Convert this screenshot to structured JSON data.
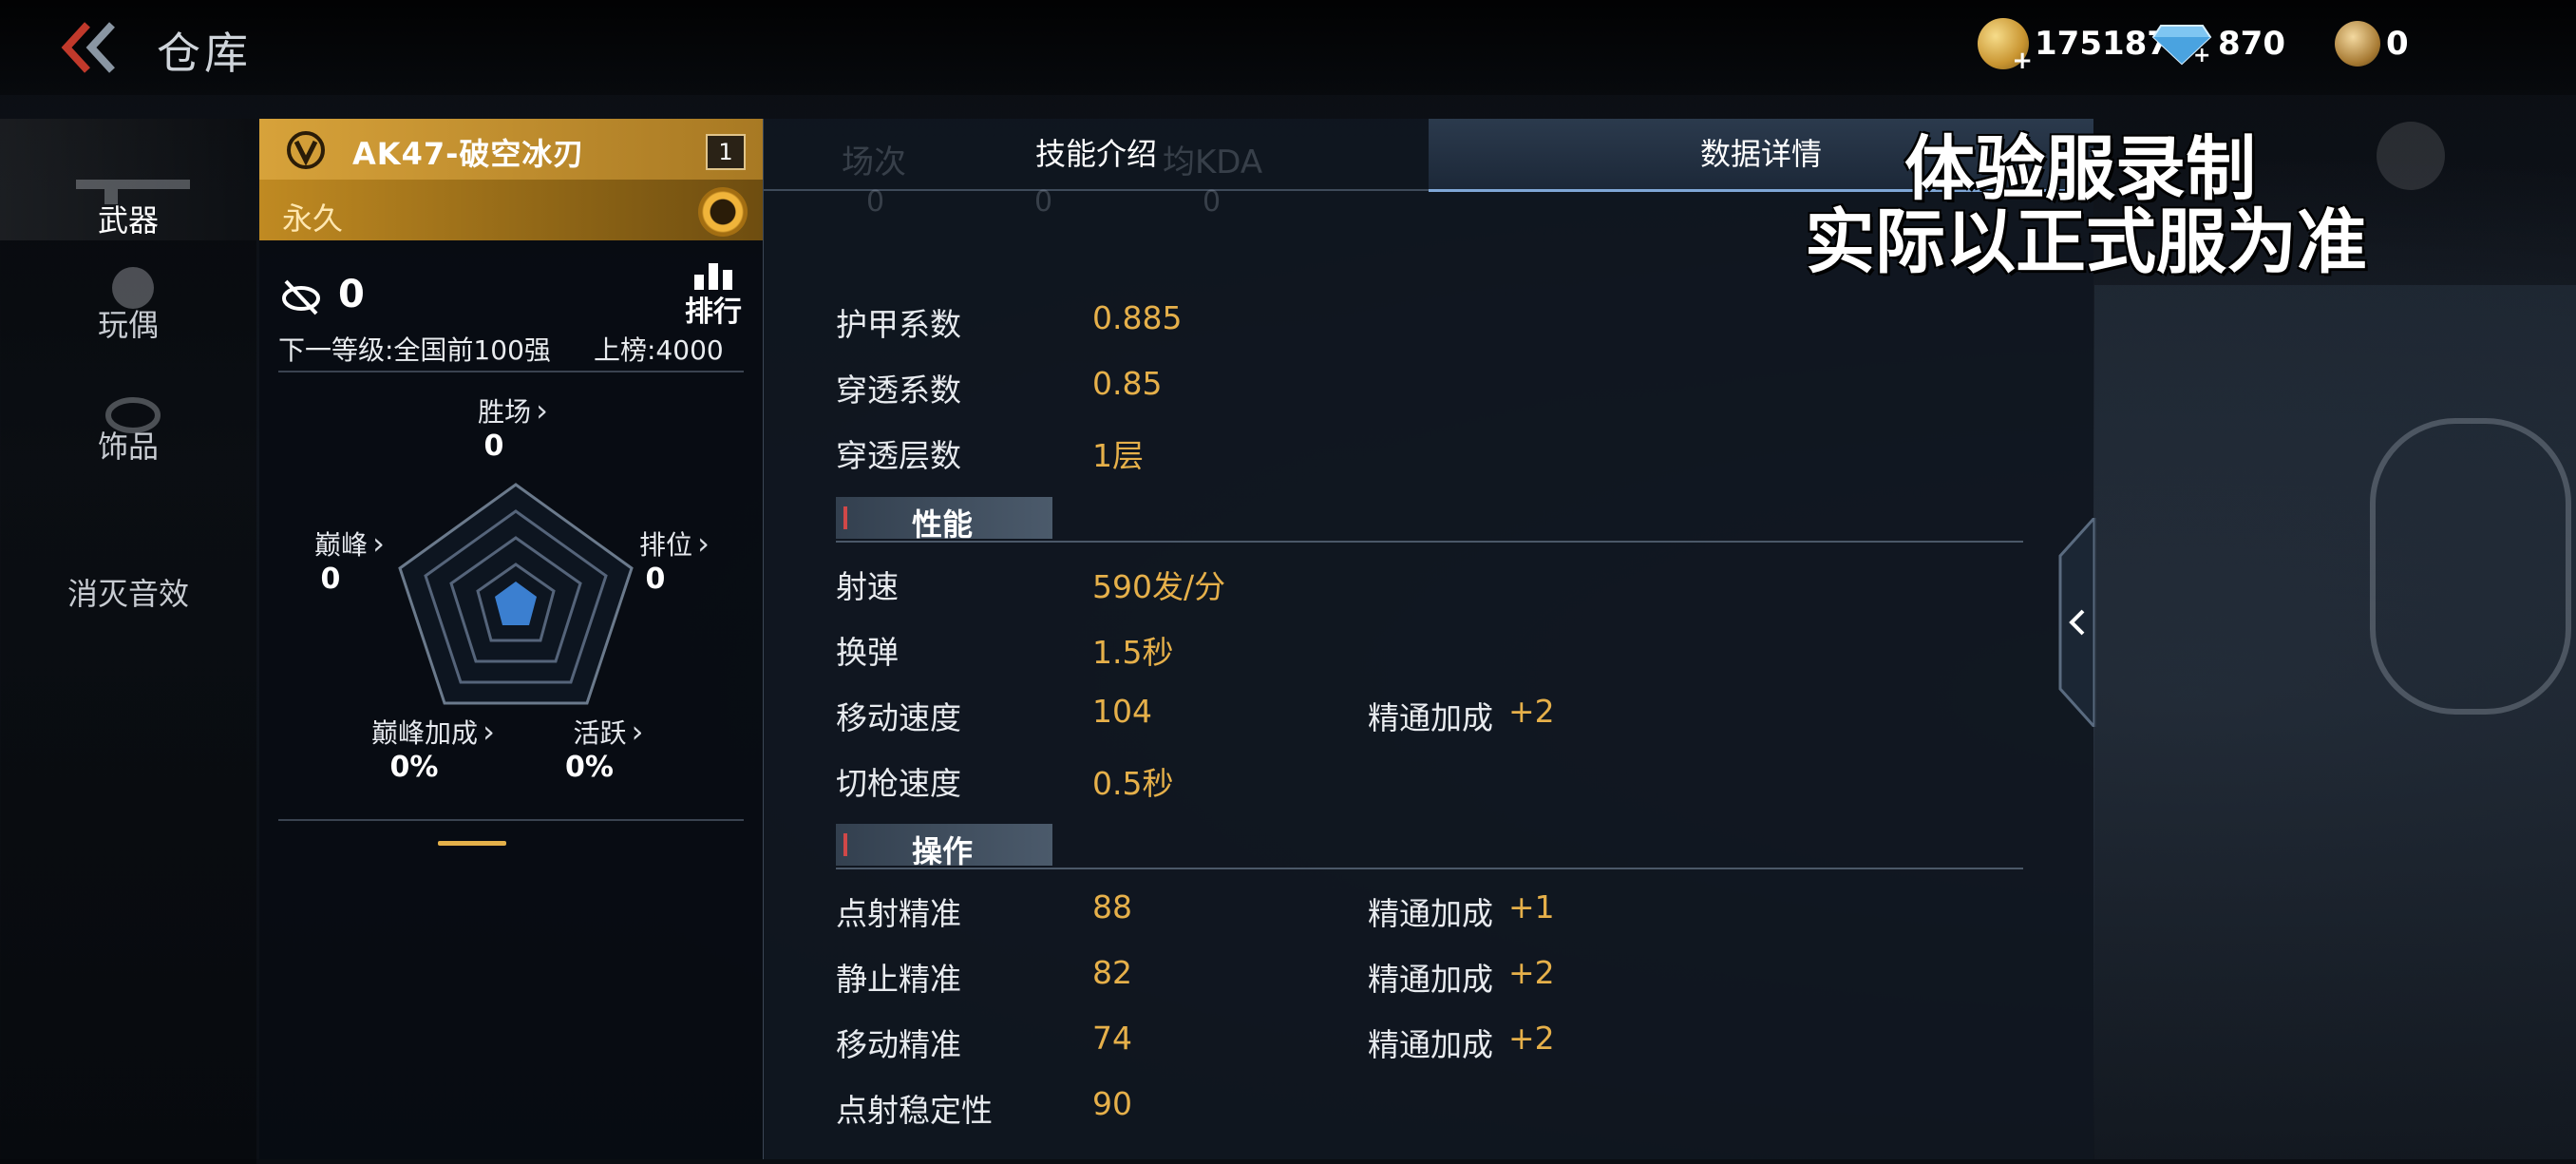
{
  "header": {
    "title": "仓库",
    "currencies": {
      "gold": "175187",
      "diamond": "870",
      "medal": "0"
    }
  },
  "sidebar": {
    "items": [
      {
        "label": "武器"
      },
      {
        "label": "玩偶"
      },
      {
        "label": "饰品"
      },
      {
        "label": "消灭音效"
      }
    ]
  },
  "card": {
    "weapon_name": "AK47-破空冰刃",
    "level": "1",
    "duration": "永久",
    "rank_count": "0",
    "rank_label": "排行",
    "next_level": "下一等级:全国前100强",
    "board_score": "上榜:4000",
    "stats": {
      "wins": {
        "label": "胜场",
        "value": "0"
      },
      "peak": {
        "label": "巅峰",
        "value": "0"
      },
      "ranked": {
        "label": "排位",
        "value": "0"
      },
      "peak_bonus": {
        "label": "巅峰加成",
        "value": "0%"
      },
      "active": {
        "label": "活跃",
        "value": "0%"
      }
    }
  },
  "panel": {
    "tabs": [
      {
        "label": "技能介绍"
      },
      {
        "label": "数据详情"
      }
    ],
    "ghost": {
      "matches": "场次",
      "kda": "均KDA",
      "zero": "0"
    },
    "rows_top": [
      {
        "key": "护甲系数",
        "value": "0.885"
      },
      {
        "key": "穿透系数",
        "value": "0.85"
      },
      {
        "key": "穿透层数",
        "value": "1层"
      }
    ],
    "section_performance": "性能",
    "rows_perf": [
      {
        "key": "射速",
        "value": "590发/分"
      },
      {
        "key": "换弹",
        "value": "1.5秒"
      },
      {
        "key": "移动速度",
        "value": "104",
        "bonus_label": "精通加成",
        "bonus": "+2"
      },
      {
        "key": "切枪速度",
        "value": "0.5秒"
      }
    ],
    "section_operation": "操作",
    "rows_op": [
      {
        "key": "点射精准",
        "value": "88",
        "bonus_label": "精通加成",
        "bonus": "+1"
      },
      {
        "key": "静止精准",
        "value": "82",
        "bonus_label": "精通加成",
        "bonus": "+2"
      },
      {
        "key": "移动精准",
        "value": "74",
        "bonus_label": "精通加成",
        "bonus": "+2"
      },
      {
        "key": "点射稳定性",
        "value": "90"
      }
    ]
  },
  "watermark": {
    "line1": "体验服录制",
    "line2": "实际以正式服为准"
  },
  "colors": {
    "accent_gold": "#e6b04a",
    "tab_active": "#1c2838"
  }
}
